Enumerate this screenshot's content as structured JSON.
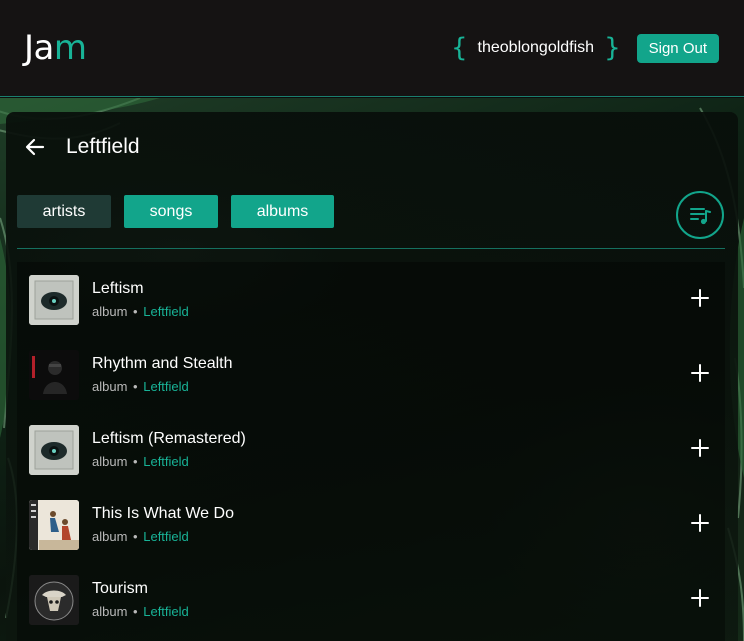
{
  "app": {
    "logo_first": "Ja",
    "logo_last": "m",
    "accent": "#12a58b"
  },
  "header": {
    "brace_open": "{",
    "brace_close": "}",
    "username": "theoblongoldfish",
    "signout_label": "Sign Out"
  },
  "page": {
    "title": "Leftfield",
    "back_icon": "arrow-left-icon"
  },
  "tabs": [
    {
      "label": "artists",
      "selected": false
    },
    {
      "label": "songs",
      "selected": true
    },
    {
      "label": "albums",
      "selected": true
    }
  ],
  "queue_icon": "playlist-music-icon",
  "results": [
    {
      "title": "Leftism",
      "type": "album",
      "separator": "•",
      "artist": "Leftfield"
    },
    {
      "title": "Rhythm and Stealth",
      "type": "album",
      "separator": "•",
      "artist": "Leftfield"
    },
    {
      "title": "Leftism (Remastered)",
      "type": "album",
      "separator": "•",
      "artist": "Leftfield"
    },
    {
      "title": "This Is What We Do",
      "type": "album",
      "separator": "•",
      "artist": "Leftfield"
    },
    {
      "title": "Tourism",
      "type": "album",
      "separator": "•",
      "artist": "Leftfield"
    }
  ]
}
